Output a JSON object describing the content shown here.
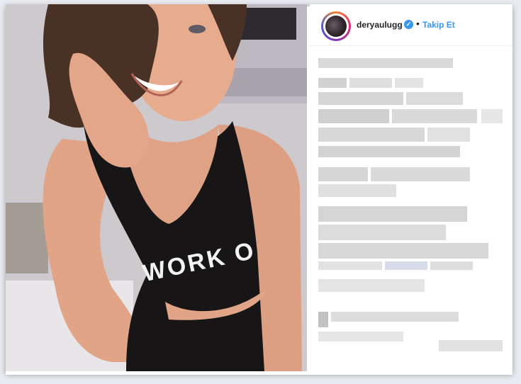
{
  "post": {
    "username": "deryaulugg",
    "verified_icon": "verified-badge-icon",
    "separator": "•",
    "follow_label": "Takip Et"
  },
  "photo": {
    "shirt_text": "WORK O"
  },
  "colors": {
    "follow": "#3897f0",
    "verified": "#3897f0",
    "story_ring_start": "#f58529",
    "story_ring_end": "#515bd4"
  }
}
